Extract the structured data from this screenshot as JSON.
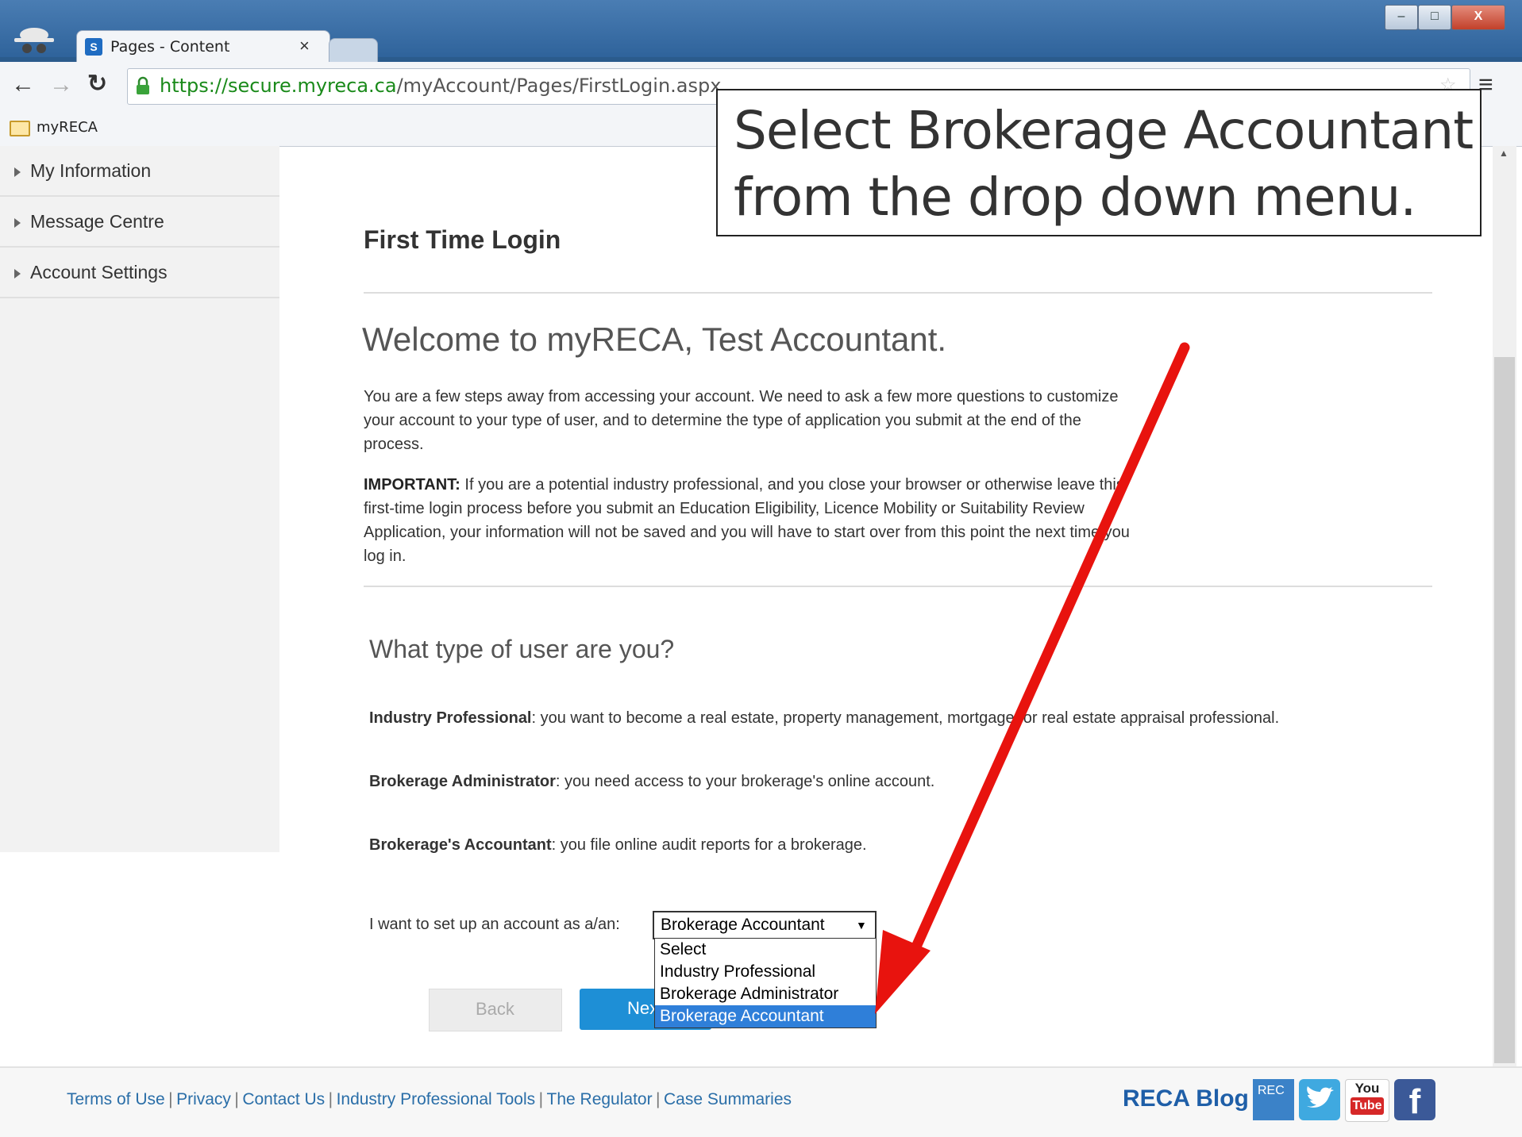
{
  "browser": {
    "tab_title": "Pages - Content",
    "tab_close": "×",
    "url_host": "https://secure.myreca.ca",
    "url_path": "/myAccount/Pages/FirstLogin.aspx",
    "bookmark": "myRECA",
    "window_controls": [
      "–",
      "□",
      "X"
    ],
    "menu_glyph": "≡"
  },
  "sidebar": {
    "items": [
      {
        "label": "My Information"
      },
      {
        "label": "Message Centre"
      },
      {
        "label": "Account Settings"
      }
    ]
  },
  "main": {
    "heading": "First Time Login",
    "welcome": "Welcome to myRECA, Test Accountant.",
    "intro": "You are a few steps away from accessing your account. We need to ask a few more questions to customize your account to your type of user, and to determine the type of application you submit at the end of the process.",
    "important_label": "IMPORTANT:",
    "important_text": " If you are a potential industry professional, and you close your browser or otherwise leave this first-time login process before you submit an Education Eligibility, Licence Mobility or Suitability Review Application, your information will not be saved and you will have to start over from this point the next time you log in.",
    "question": "What type of user are you?",
    "types": [
      {
        "term": "Industry Professional",
        "desc": ": you want to become a real estate, property management, mortgage, or real estate appraisal professional."
      },
      {
        "term": "Brokerage Administrator",
        "desc": ": you need access to your brokerage's online account."
      },
      {
        "term": "Brokerage's Accountant",
        "desc": ": you file online audit reports for a brokerage."
      }
    ],
    "select_label": "I want to set up an account as a/an:",
    "select_value": "Brokerage Accountant",
    "select_arrow": "▼",
    "options": [
      "Select",
      "Industry Professional",
      "Brokerage Administrator",
      "Brokerage Accountant"
    ],
    "back_label": "Back",
    "next_label": "Next"
  },
  "footer": {
    "links": [
      "Terms of Use",
      "Privacy",
      "Contact Us",
      "Industry Professional Tools",
      "The Regulator",
      "Case Summaries"
    ],
    "separator": "|",
    "blog_label": "RECA Blog",
    "reca_icon_text": "REC",
    "youtube_top": "You",
    "youtube_bottom": "Tube",
    "facebook_letter": "f"
  },
  "annotation": {
    "line1": "Select Brokerage Accountant",
    "line2": "from the drop down menu."
  },
  "colors": {
    "arrow": "#e8130e",
    "link": "#2a6ea8",
    "next_button": "#1e8fd6",
    "selected_option": "#2f7fd9"
  }
}
